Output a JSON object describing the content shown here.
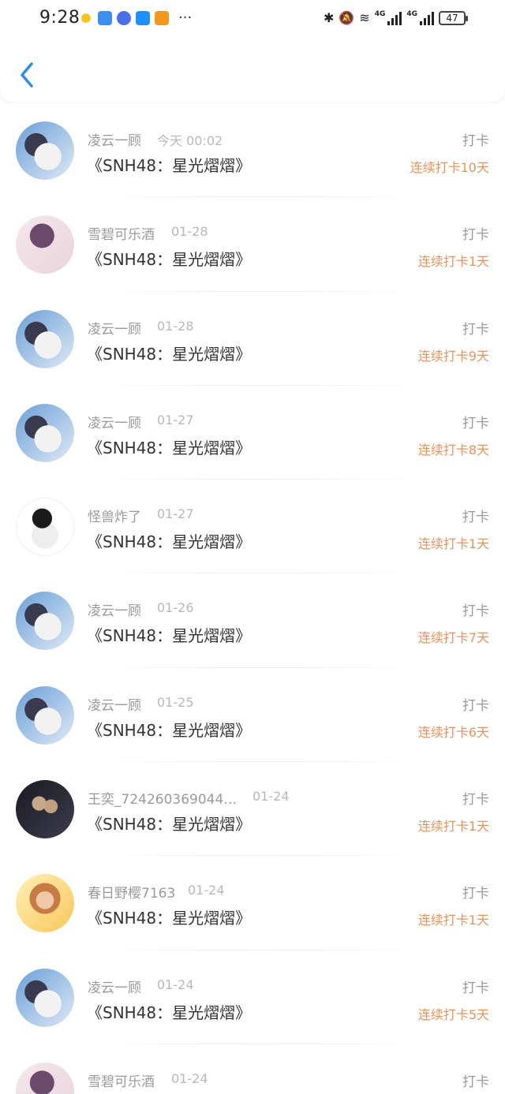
{
  "status_bar": {
    "time": "9:28",
    "more": "···",
    "battery": "47",
    "network_1": "4G",
    "network_2": "4G"
  },
  "header": {
    "back_icon": "chevron-left-icon"
  },
  "colors": {
    "accent_blue": "#2f8fe8",
    "streak_orange": "#e8935a"
  },
  "items": [
    {
      "name": "凌云一顾",
      "date": "今天 00:02",
      "title": "《SNH48：星光熠熠》",
      "type": "打卡",
      "streak": "连续打卡10天"
    },
    {
      "name": "雪碧可乐酒",
      "date": "01-28",
      "title": "《SNH48：星光熠熠》",
      "type": "打卡",
      "streak": "连续打卡1天"
    },
    {
      "name": "凌云一顾",
      "date": "01-28",
      "title": "《SNH48：星光熠熠》",
      "type": "打卡",
      "streak": "连续打卡9天"
    },
    {
      "name": "凌云一顾",
      "date": "01-27",
      "title": "《SNH48：星光熠熠》",
      "type": "打卡",
      "streak": "连续打卡8天"
    },
    {
      "name": "怪兽炸了",
      "date": "01-27",
      "title": "《SNH48：星光熠熠》",
      "type": "打卡",
      "streak": "连续打卡1天"
    },
    {
      "name": "凌云一顾",
      "date": "01-26",
      "title": "《SNH48：星光熠熠》",
      "type": "打卡",
      "streak": "连续打卡7天"
    },
    {
      "name": "凌云一顾",
      "date": "01-25",
      "title": "《SNH48：星光熠熠》",
      "type": "打卡",
      "streak": "连续打卡6天"
    },
    {
      "name": "王奕_7242603690447...",
      "date": "01-24",
      "title": "《SNH48：星光熠熠》",
      "type": "打卡",
      "streak": "连续打卡1天"
    },
    {
      "name": "春日野樱7163",
      "date": "01-24",
      "title": "《SNH48：星光熠熠》",
      "type": "打卡",
      "streak": "连续打卡1天"
    },
    {
      "name": "凌云一顾",
      "date": "01-24",
      "title": "《SNH48：星光熠熠》",
      "type": "打卡",
      "streak": "连续打卡5天"
    },
    {
      "name": "雪碧可乐酒",
      "date": "01-24",
      "title": "",
      "type": "打卡",
      "streak": ""
    }
  ]
}
